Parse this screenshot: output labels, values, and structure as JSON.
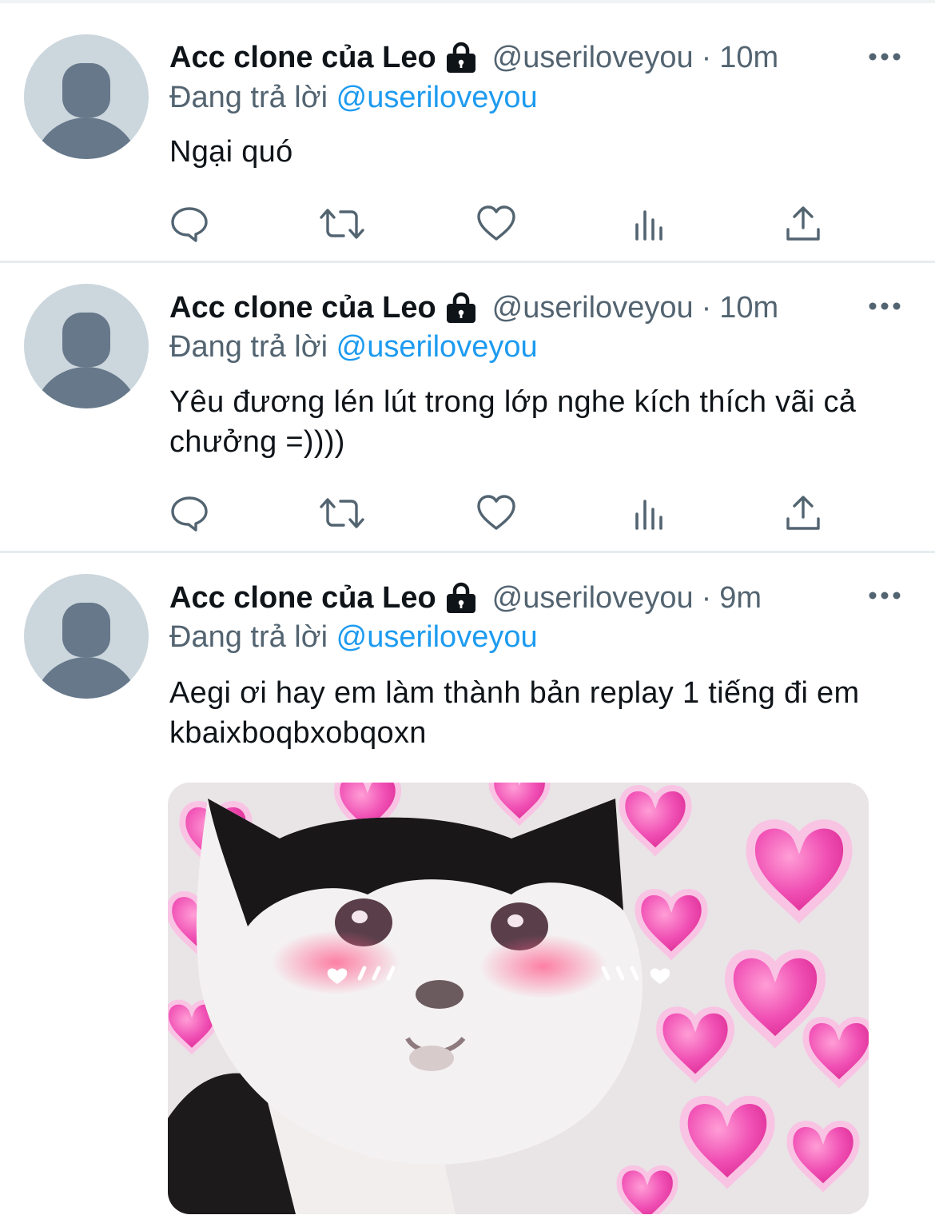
{
  "tweets": [
    {
      "name": "Acc clone của Leo",
      "handle": "@useriloveyou",
      "separator": "·",
      "time": "10m",
      "reply_prefix": "Đang trả lời",
      "reply_to": "@useriloveyou",
      "text": "Ngại quó"
    },
    {
      "name": "Acc clone của Leo",
      "handle": "@useriloveyou",
      "separator": "·",
      "time": "10m",
      "reply_prefix": "Đang trả lời",
      "reply_to": "@useriloveyou",
      "text": "Yêu đương lén lút trong lớp nghe kích thích vãi cả chưởng =))))"
    },
    {
      "name": "Acc clone của Leo",
      "handle": "@useriloveyou",
      "separator": "·",
      "time": "9m",
      "reply_prefix": "Đang trả lời",
      "reply_to": "@useriloveyou",
      "text": "Aegi ơi hay em làm thành bản replay 1 tiếng đi em kbaixboqbxobqoxn",
      "media": "image: crying black-and-white cat with blushing cheeks surrounded by pink hearts"
    }
  ],
  "icons": {
    "protected": "lock-icon",
    "more": "more-dots-icon",
    "reply": "reply-icon",
    "retweet": "retweet-icon",
    "like": "heart-icon",
    "analytics": "analytics-icon",
    "share": "share-icon"
  },
  "colors": {
    "text": "#0f1419",
    "secondary": "#536471",
    "link": "#1d9bf0",
    "avatar_bg": "#ccd6dd",
    "avatar_fg": "#66788a",
    "divider": "#e6ecf0"
  }
}
